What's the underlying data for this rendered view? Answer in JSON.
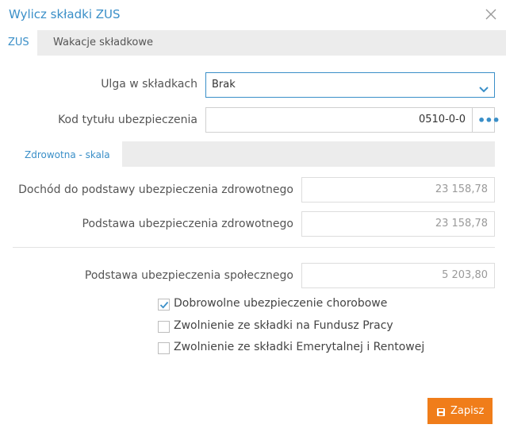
{
  "dialog": {
    "title": "Wylicz składki ZUS"
  },
  "tabs": [
    {
      "label": "ZUS",
      "active": true
    },
    {
      "label": "Wakacje składkowe",
      "active": false
    }
  ],
  "form": {
    "ulga_label": "Ulga w składkach",
    "ulga_value": "Brak",
    "kod_label": "Kod tytułu ubezpieczenia",
    "kod_value": "0510-0-0"
  },
  "subtabs": [
    {
      "label": "Zdrowotna - skala",
      "active": true
    }
  ],
  "health": {
    "dochod_label": "Dochód do podstawy ubezpieczenia zdrowotnego",
    "dochod_value": "23 158,78",
    "podstawa_label": "Podstawa ubezpieczenia zdrowotnego",
    "podstawa_value": "23 158,78"
  },
  "social": {
    "label": "Podstawa ubezpieczenia społecznego",
    "value": "5 203,80"
  },
  "checkboxes": [
    {
      "label": "Dobrowolne ubezpieczenie chorobowe",
      "checked": true
    },
    {
      "label": "Zwolnienie ze składki na Fundusz Pracy",
      "checked": false
    },
    {
      "label": "Zwolnienie ze składki Emerytalnej i Rentowej",
      "checked": false
    }
  ],
  "actions": {
    "save_label": "Zapisz"
  },
  "colors": {
    "accent": "#3a8fc8",
    "save_button": "#f07d1a"
  }
}
